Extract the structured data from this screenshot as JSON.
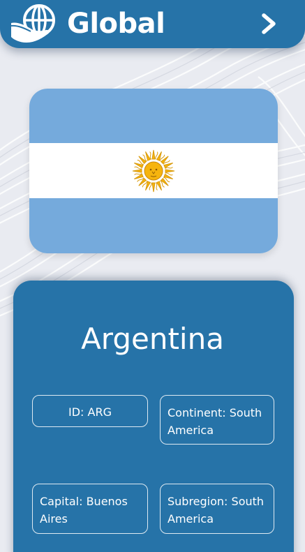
{
  "header": {
    "app_title": "Global",
    "logo_icon": "globe-hand-icon",
    "next_icon": "chevron-right-icon"
  },
  "flag": {
    "country_code": "ARG",
    "colors": {
      "sky_blue": "#75aadc",
      "white": "#ffffff",
      "sun": "#f6b40e"
    },
    "emblem_icon": "sun-of-may-icon"
  },
  "country": {
    "name": "Argentina",
    "id_text": "ID: ARG",
    "continent_text": "Continent: South America",
    "capital_text": "Capital: Buenos Aires",
    "subregion_text": "Subregion: South America"
  },
  "theme": {
    "primary": "#2673a8",
    "background": "#e9ebf1"
  }
}
